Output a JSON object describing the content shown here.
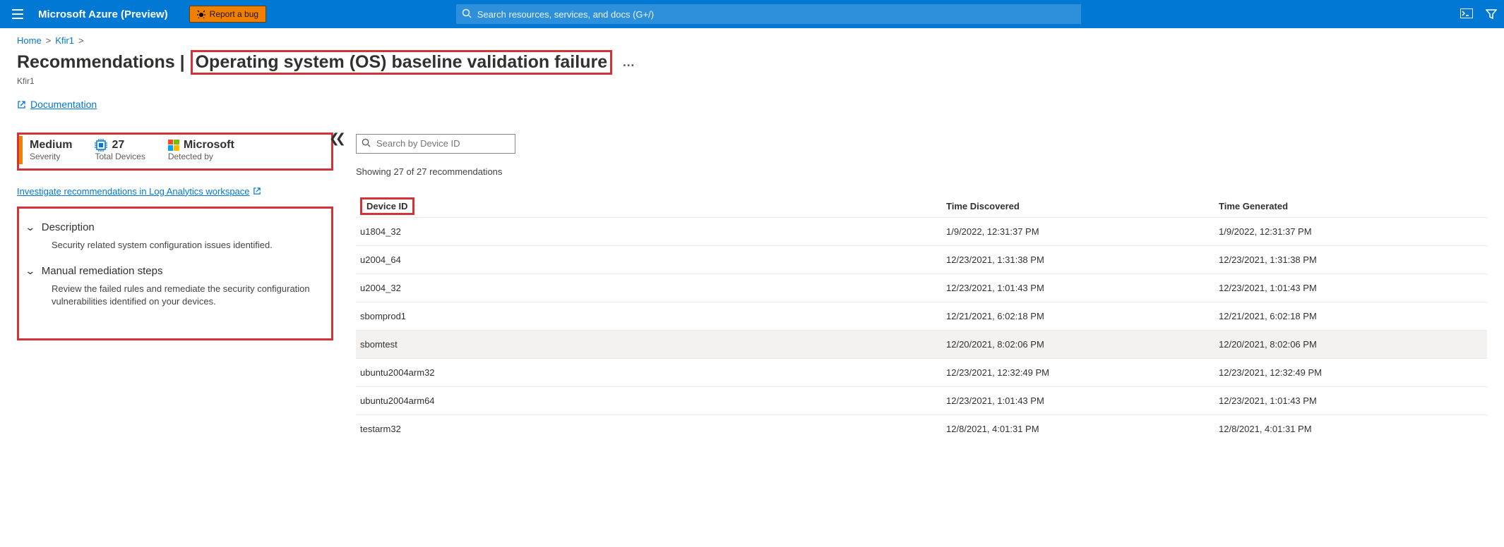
{
  "header": {
    "brand": "Microsoft Azure (Preview)",
    "report_bug": "Report a bug",
    "search_placeholder": "Search resources, services, and docs (G+/)"
  },
  "breadcrumbs": {
    "home": "Home",
    "item": "Kfir1"
  },
  "page": {
    "title_prefix": "Recommendations | ",
    "title_highlight": "Operating system (OS) baseline validation failure",
    "subtitle": "Kfir1",
    "more": "…",
    "doc_link": "Documentation"
  },
  "stats": {
    "severity": {
      "value": "Medium",
      "label": "Severity"
    },
    "devices": {
      "value": "27",
      "label": "Total Devices"
    },
    "detected": {
      "value": "Microsoft",
      "label": "Detected by"
    }
  },
  "investigate_link": "Investigate recommendations in Log Analytics workspace",
  "sections": {
    "description": {
      "title": "Description",
      "body": "Security related system configuration issues identified."
    },
    "remediation": {
      "title": "Manual remediation steps",
      "body": "Review the failed rules and remediate the security configuration vulnerabilities identified on your devices."
    }
  },
  "right": {
    "filter_placeholder": "Search by Device ID",
    "showing": "Showing 27 of 27 recommendations",
    "columns": {
      "c1": "Device ID",
      "c2": "Time Discovered",
      "c3": "Time Generated"
    },
    "rows": [
      {
        "id": "u1804_32",
        "disc": "1/9/2022, 12:31:37 PM",
        "gen": "1/9/2022, 12:31:37 PM"
      },
      {
        "id": "u2004_64",
        "disc": "12/23/2021, 1:31:38 PM",
        "gen": "12/23/2021, 1:31:38 PM"
      },
      {
        "id": "u2004_32",
        "disc": "12/23/2021, 1:01:43 PM",
        "gen": "12/23/2021, 1:01:43 PM"
      },
      {
        "id": "sbomprod1",
        "disc": "12/21/2021, 6:02:18 PM",
        "gen": "12/21/2021, 6:02:18 PM"
      },
      {
        "id": "sbomtest",
        "disc": "12/20/2021, 8:02:06 PM",
        "gen": "12/20/2021, 8:02:06 PM"
      },
      {
        "id": "ubuntu2004arm32",
        "disc": "12/23/2021, 12:32:49 PM",
        "gen": "12/23/2021, 12:32:49 PM"
      },
      {
        "id": "ubuntu2004arm64",
        "disc": "12/23/2021, 1:01:43 PM",
        "gen": "12/23/2021, 1:01:43 PM"
      },
      {
        "id": "testarm32",
        "disc": "12/8/2021, 4:01:31 PM",
        "gen": "12/8/2021, 4:01:31 PM"
      }
    ]
  }
}
